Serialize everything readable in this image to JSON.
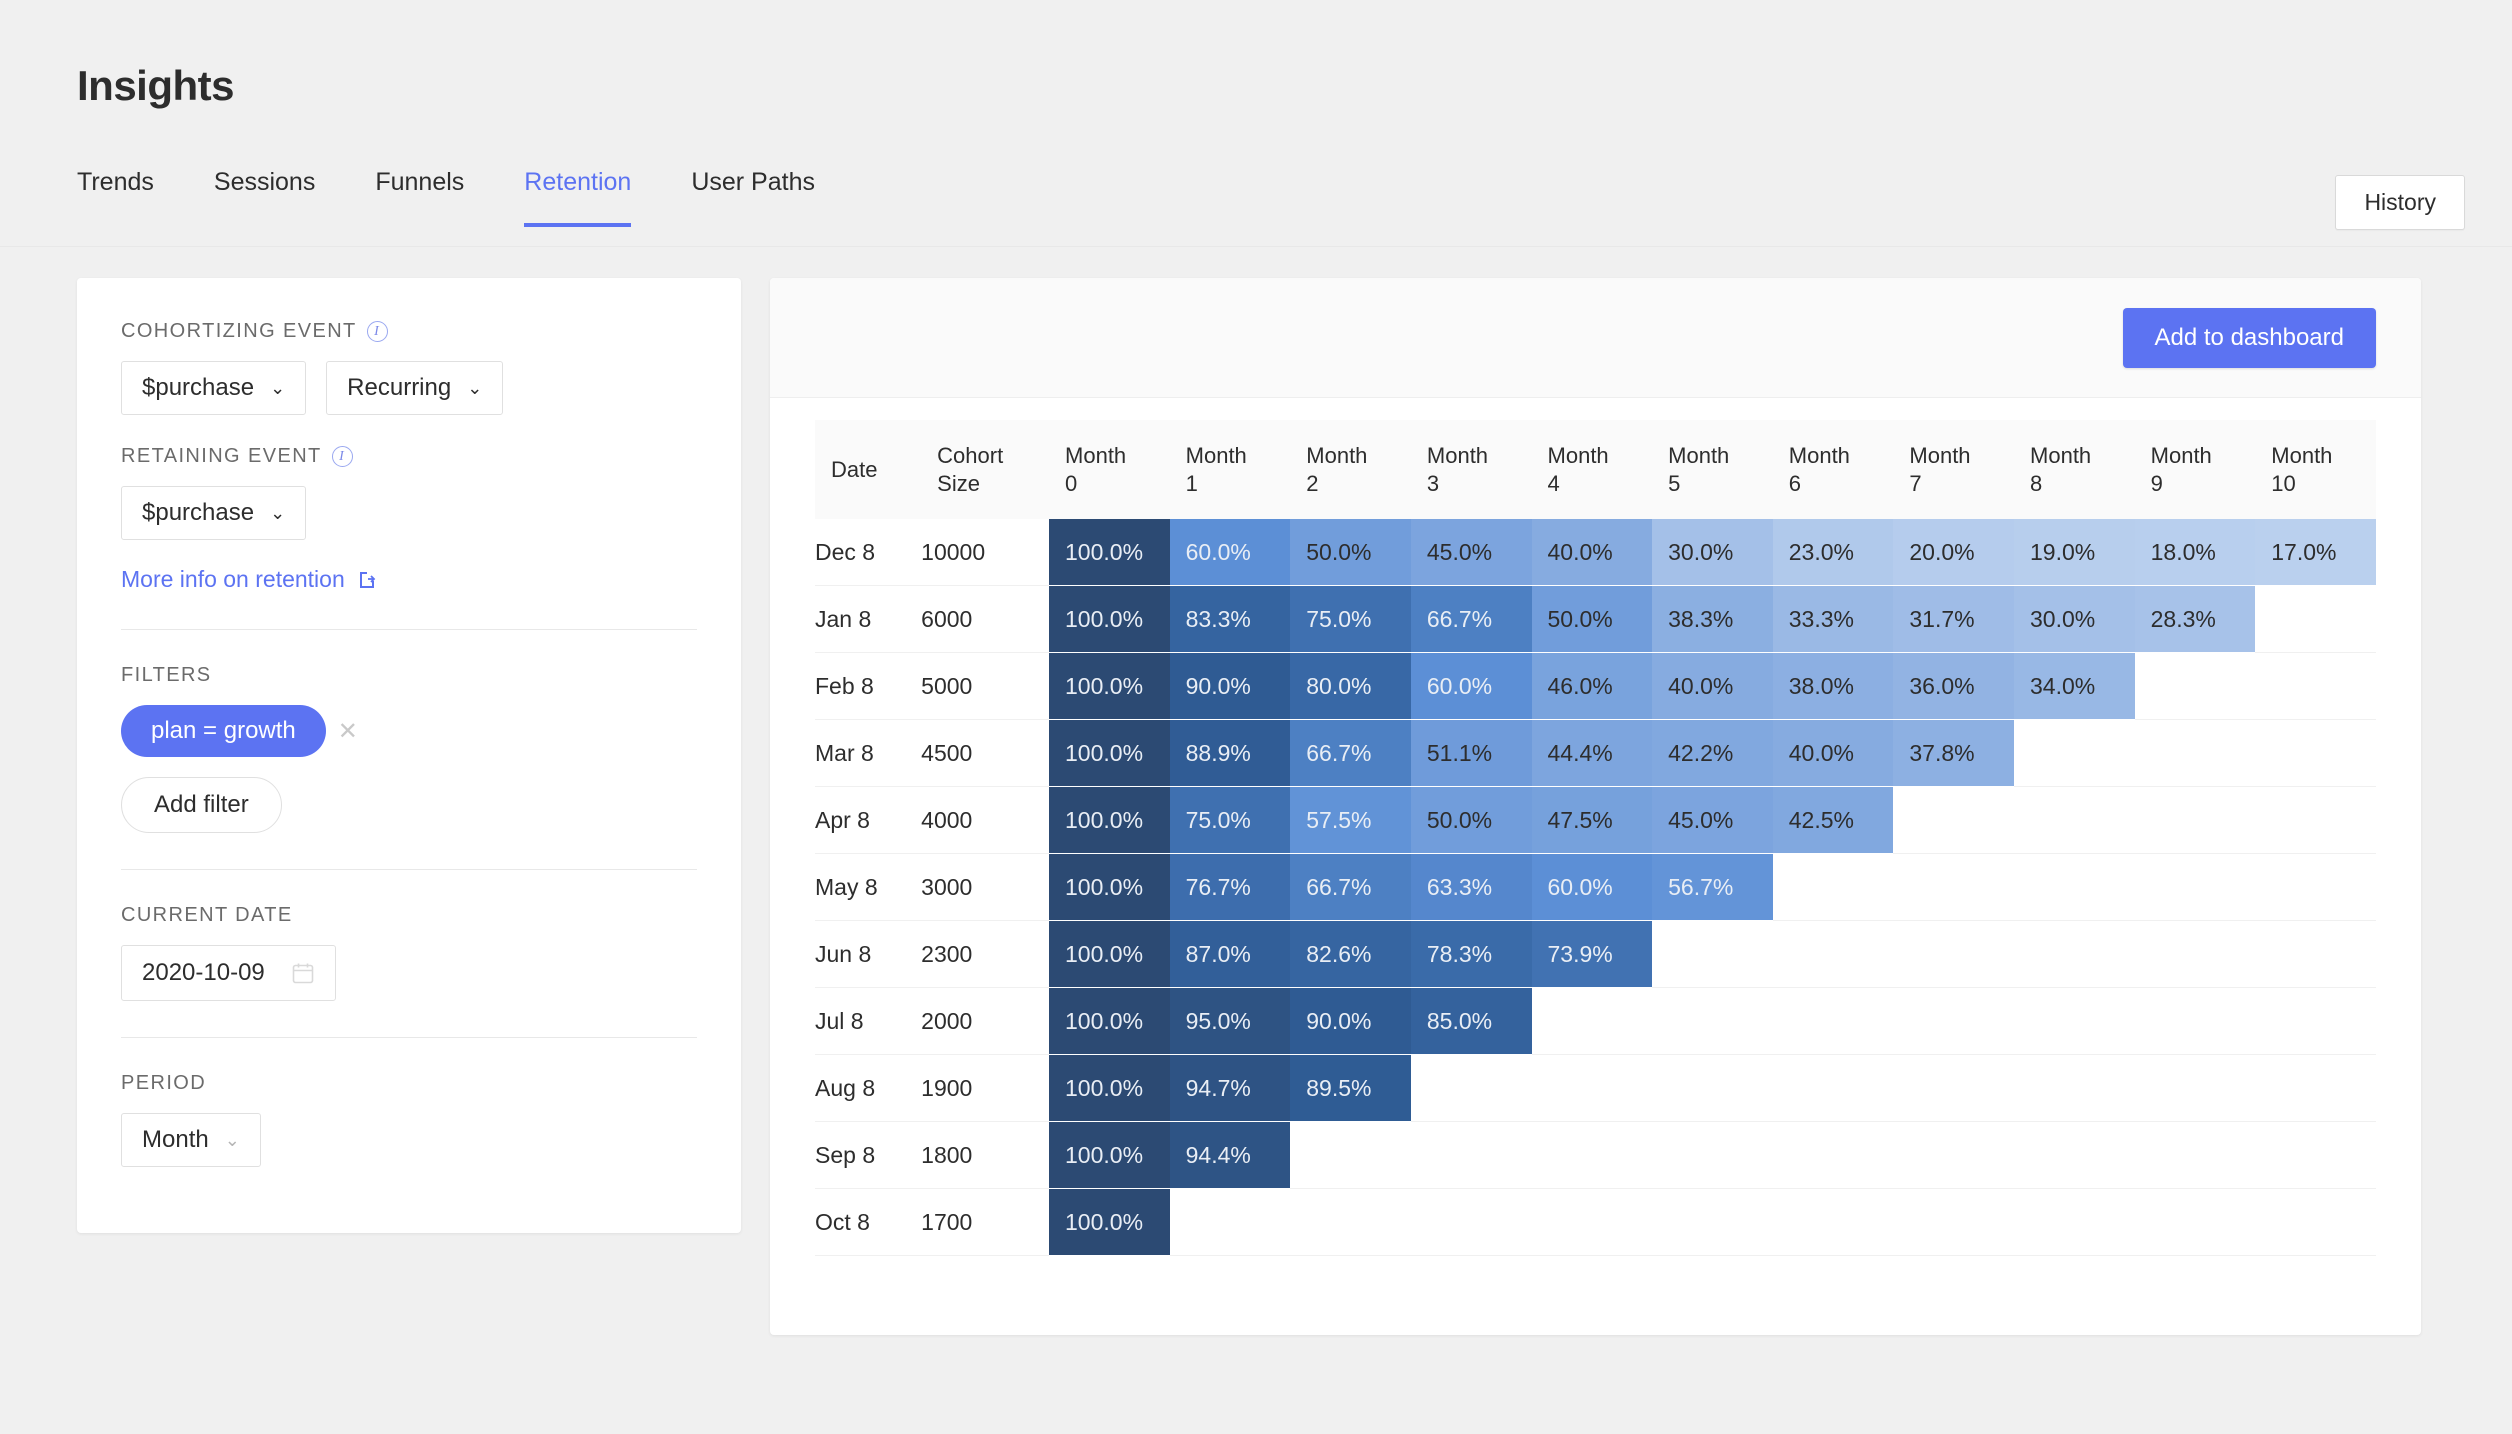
{
  "header": {
    "title": "Insights",
    "tabs": [
      {
        "label": "Trends",
        "active": false
      },
      {
        "label": "Sessions",
        "active": false
      },
      {
        "label": "Funnels",
        "active": false
      },
      {
        "label": "Retention",
        "active": true
      },
      {
        "label": "User Paths",
        "active": false
      }
    ],
    "history_button": "History"
  },
  "sidebar": {
    "cohortizing_label": "COHORTIZING EVENT",
    "cohortizing_event": "$purchase",
    "cohortizing_type": "Recurring",
    "retaining_label": "RETAINING EVENT",
    "retaining_event": "$purchase",
    "more_info_link": "More info on retention",
    "filters_label": "FILTERS",
    "filter_pills": [
      "plan = growth"
    ],
    "add_filter_button": "Add filter",
    "current_date_label": "CURRENT DATE",
    "current_date_value": "2020-10-09",
    "period_label": "PERIOD",
    "period_value": "Month"
  },
  "main": {
    "add_to_dashboard_button": "Add to dashboard"
  },
  "colors": {
    "accent": "#5c73f2",
    "heat_full": "#2c4a73",
    "heat_min": "#c3d5ee",
    "page_bg": "#f0f0f0"
  },
  "chart_data": {
    "type": "heatmap",
    "title": "Retention cohort table",
    "columns": [
      "Date",
      "Cohort Size",
      "Month 0",
      "Month 1",
      "Month 2",
      "Month 3",
      "Month 4",
      "Month 5",
      "Month 6",
      "Month 7",
      "Month 8",
      "Month 9",
      "Month 10"
    ],
    "xlabel": "Month",
    "ylabel": "Date",
    "unit": "%",
    "rows": [
      {
        "date": "Dec 8",
        "size": "10000",
        "values": [
          100.0,
          60.0,
          50.0,
          45.0,
          40.0,
          30.0,
          23.0,
          20.0,
          19.0,
          18.0,
          17.0
        ]
      },
      {
        "date": "Jan 8",
        "size": "6000",
        "values": [
          100.0,
          83.3,
          75.0,
          66.7,
          50.0,
          38.3,
          33.3,
          31.7,
          30.0,
          28.3
        ]
      },
      {
        "date": "Feb 8",
        "size": "5000",
        "values": [
          100.0,
          90.0,
          80.0,
          60.0,
          46.0,
          40.0,
          38.0,
          36.0,
          34.0
        ]
      },
      {
        "date": "Mar 8",
        "size": "4500",
        "values": [
          100.0,
          88.9,
          66.7,
          51.1,
          44.4,
          42.2,
          40.0,
          37.8
        ]
      },
      {
        "date": "Apr 8",
        "size": "4000",
        "values": [
          100.0,
          75.0,
          57.5,
          50.0,
          47.5,
          45.0,
          42.5
        ]
      },
      {
        "date": "May 8",
        "size": "3000",
        "values": [
          100.0,
          76.7,
          66.7,
          63.3,
          60.0,
          56.7
        ]
      },
      {
        "date": "Jun 8",
        "size": "2300",
        "values": [
          100.0,
          87.0,
          82.6,
          78.3,
          73.9
        ]
      },
      {
        "date": "Jul 8",
        "size": "2000",
        "values": [
          100.0,
          95.0,
          90.0,
          85.0
        ]
      },
      {
        "date": "Aug 8",
        "size": "1900",
        "values": [
          100.0,
          94.7,
          89.5
        ]
      },
      {
        "date": "Sep 8",
        "size": "1800",
        "values": [
          100.0,
          94.4
        ]
      },
      {
        "date": "Oct 8",
        "size": "1700",
        "values": [
          100.0
        ]
      }
    ]
  }
}
